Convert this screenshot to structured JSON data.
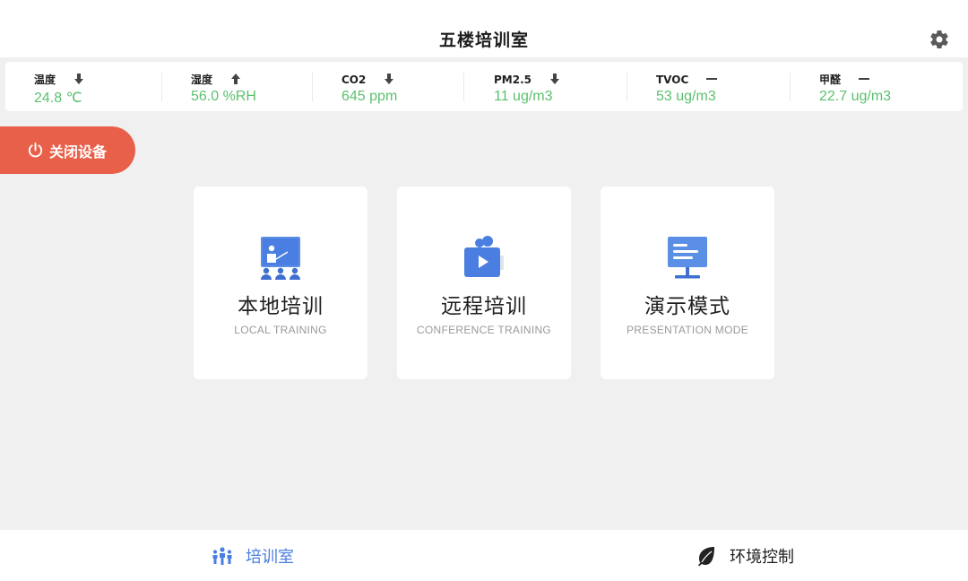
{
  "header": {
    "title": "五楼培训室",
    "settings_icon": "gear-icon"
  },
  "sensors": [
    {
      "name": "温度",
      "value": "24.8 ℃",
      "trend": "down"
    },
    {
      "name": "湿度",
      "value": "56.0 %RH",
      "trend": "up"
    },
    {
      "name": "CO2",
      "value": "645 ppm",
      "trend": "down"
    },
    {
      "name": "PM2.5",
      "value": "11 ug/m3",
      "trend": "down"
    },
    {
      "name": "TVOC",
      "value": "53 ug/m3",
      "trend": "flat"
    },
    {
      "name": "甲醛",
      "value": "22.7 ug/m3",
      "trend": "flat"
    }
  ],
  "power": {
    "label": "关闭设备",
    "icon": "power-icon"
  },
  "modes": [
    {
      "title": "本地培训",
      "subtitle": "LOCAL TRAINING",
      "icon": "classroom-icon"
    },
    {
      "title": "远程培训",
      "subtitle": "CONFERENCE TRAINING",
      "icon": "video-camera-icon"
    },
    {
      "title": "演示模式",
      "subtitle": "PRESENTATION MODE",
      "icon": "monitor-icon"
    }
  ],
  "nav": {
    "training_room": {
      "label": "培训室",
      "active": true,
      "icon": "people-icon"
    },
    "environment": {
      "label": "环境控制",
      "active": false,
      "icon": "leaf-icon"
    }
  },
  "colors": {
    "accent_blue": "#4a7ee0",
    "value_green": "#5cc06e",
    "power_red": "#e9604a",
    "background": "#f0f0f0"
  }
}
